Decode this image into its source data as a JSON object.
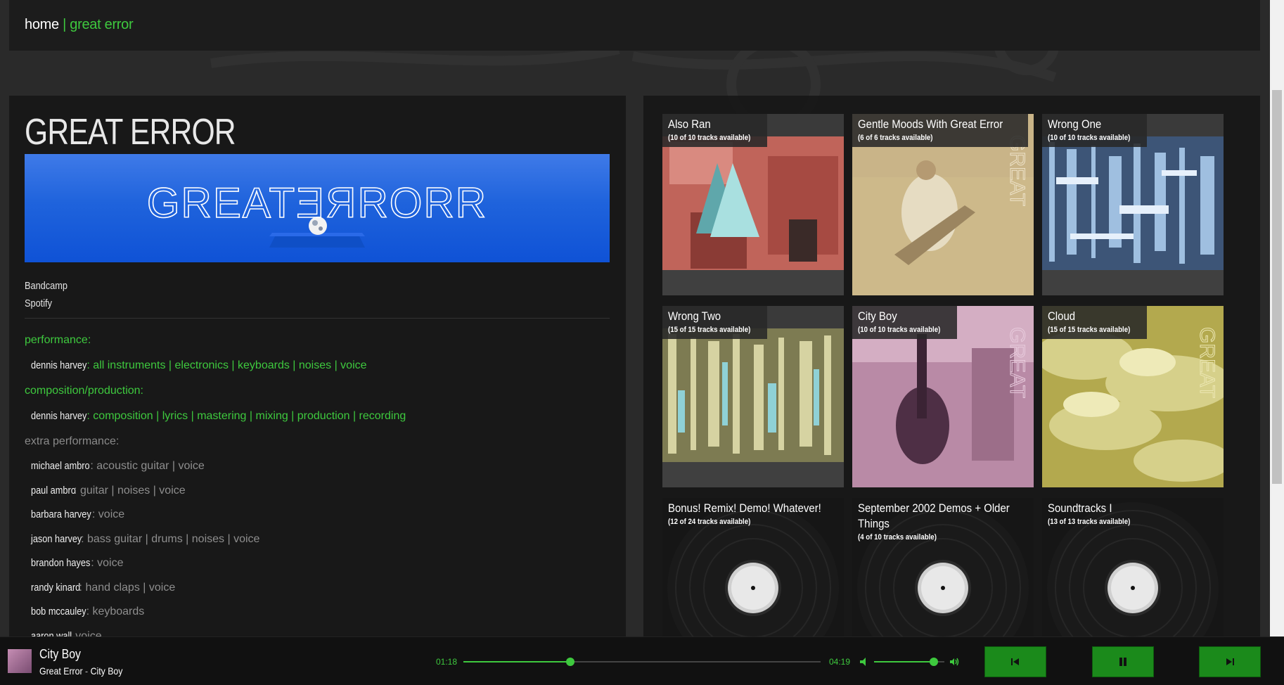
{
  "breadcrumb": {
    "home": "home",
    "separator": "|",
    "current": "great error"
  },
  "artist": {
    "name": "GREAT ERROR",
    "banner_logo_text": "GREATƎЯRORR",
    "links": [
      "Bandcamp",
      "Spotify"
    ]
  },
  "credits": {
    "performance": {
      "heading": "performance:",
      "rows": [
        {
          "person": "dennis harvey",
          "roles": "all instruments | electronics | keyboards | noises | voice"
        }
      ]
    },
    "composition": {
      "heading": "composition/production:",
      "rows": [
        {
          "person": "dennis harvey",
          "roles": "composition | lyrics | mastering | mixing | production | recording"
        }
      ]
    },
    "extra": {
      "heading": "extra performance:",
      "rows": [
        {
          "person": "michael ambro",
          "roles": "acoustic guitar | voice"
        },
        {
          "person": "paul ambro",
          "roles": "guitar | noises | voice"
        },
        {
          "person": "barbara harvey",
          "roles": "voice"
        },
        {
          "person": "jason harvey",
          "roles": "bass guitar | drums | noises | voice"
        },
        {
          "person": "brandon hayes",
          "roles": "voice"
        },
        {
          "person": "randy kinard",
          "roles": "hand claps | voice"
        },
        {
          "person": "bob mccauley",
          "roles": "keyboards"
        },
        {
          "person": "aaron wall",
          "roles": "voice"
        }
      ]
    }
  },
  "albums": [
    {
      "title": "Also Ran",
      "count": "(10 of 10 tracks available)",
      "art": "icon-triangles-on-red-photo"
    },
    {
      "title": "Gentle Moods With Great Error",
      "count": "(6 of 6 tracks available)",
      "art": "sepia-beach-photo"
    },
    {
      "title": "Wrong One",
      "count": "(10 of 10 tracks available)",
      "art": "blue-glitch-pattern"
    },
    {
      "title": "Wrong Two",
      "count": "(15 of 15 tracks available)",
      "art": "yellow-glitch-pattern"
    },
    {
      "title": "City Boy",
      "count": "(10 of 10 tracks available)",
      "art": "pink-guitar-photo"
    },
    {
      "title": "Cloud",
      "count": "(15 of 15 tracks available)",
      "art": "yellow-clouds-photo"
    },
    {
      "title": "Bonus! Remix! Demo! Whatever!",
      "count": "(12 of 24 tracks available)",
      "art": "vinyl-record-icon"
    },
    {
      "title": "September 2002 Demos + Older Things",
      "count": "(4 of 10 tracks available)",
      "art": "vinyl-record-icon"
    },
    {
      "title": "Soundtracks I",
      "count": "(13 of 13 tracks available)",
      "art": "vinyl-record-icon"
    }
  ],
  "player": {
    "title": "City Boy",
    "artist": "Great Error",
    "separator": "-",
    "album": "City Boy",
    "elapsed": "01:18",
    "duration": "04:19",
    "progress_fraction": 0.3,
    "volume_fraction": 0.85,
    "controls": [
      "previous-icon",
      "pause-icon",
      "next-icon"
    ]
  },
  "colors": {
    "accent": "#3ec93e",
    "button_green": "#1b8a1b",
    "panel": "#161616",
    "background": "#2a2a2a"
  }
}
